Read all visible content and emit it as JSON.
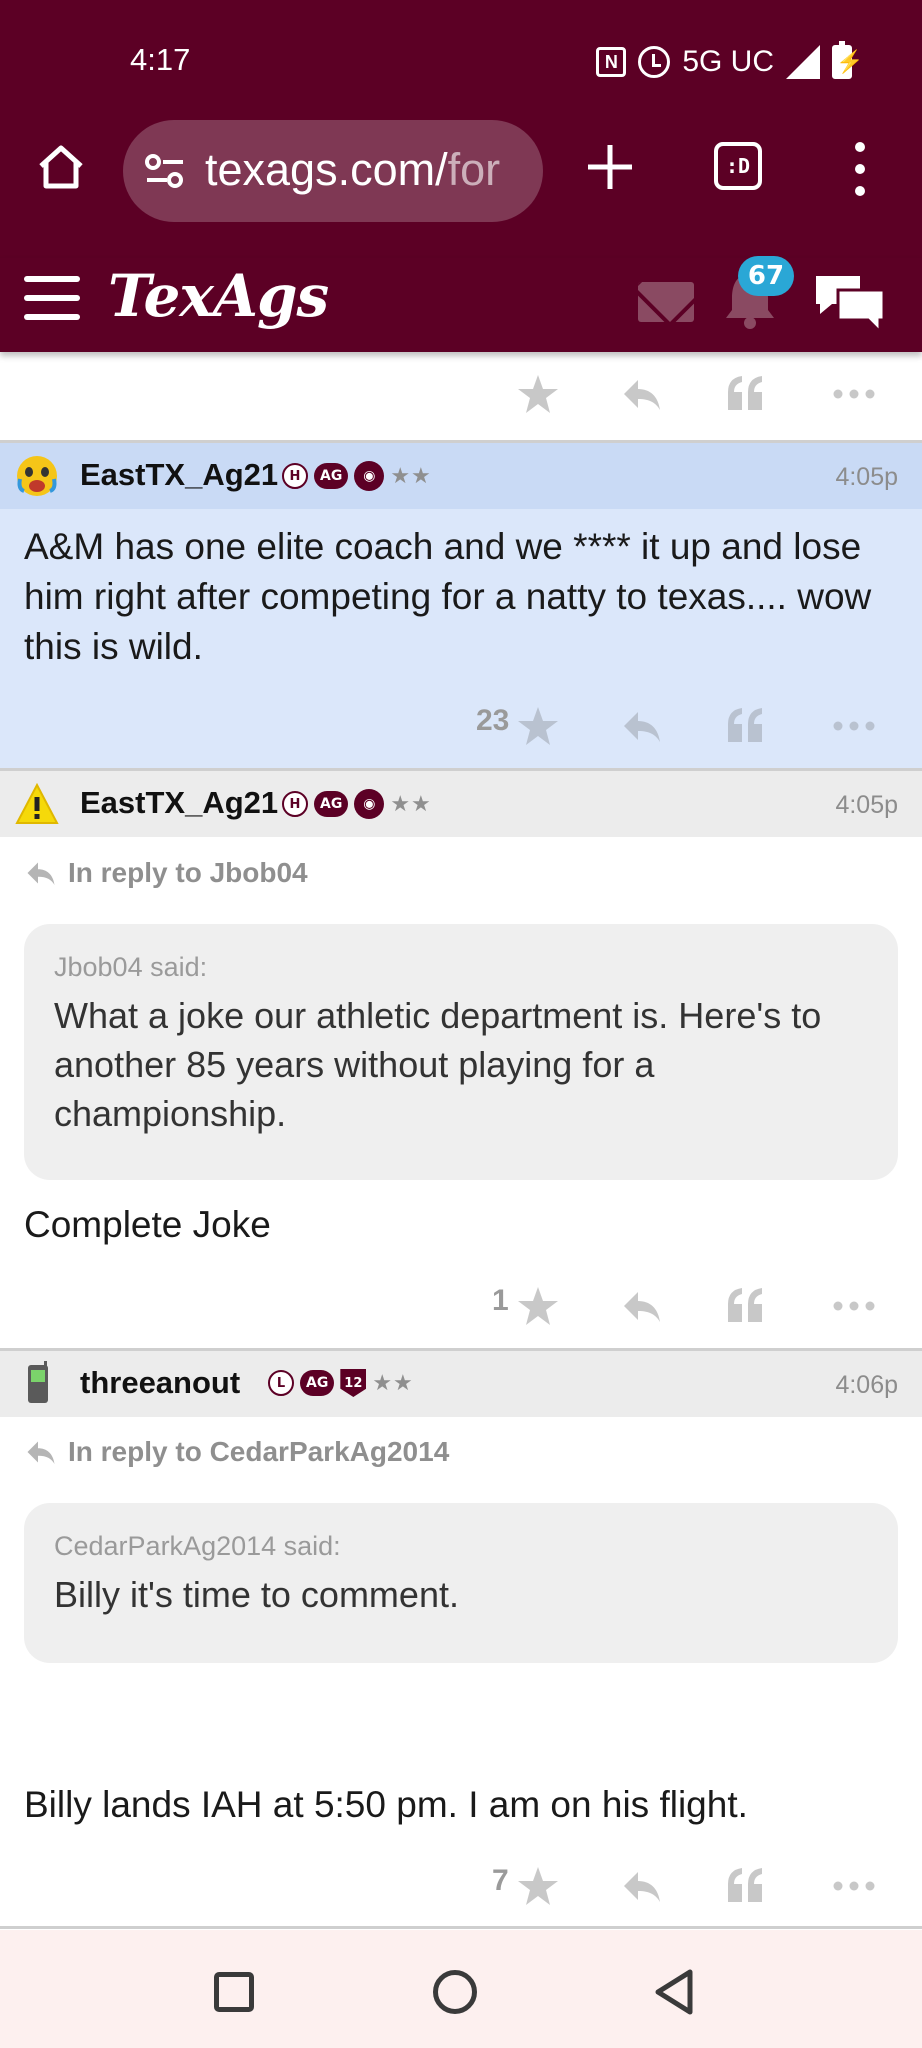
{
  "status_bar": {
    "time": "4:17",
    "network": "5G UC"
  },
  "browser": {
    "url_main": "texags.com/",
    "url_faded": "for",
    "tabs_count": ":D"
  },
  "site": {
    "logo": "TexAgs",
    "notification_count": "67",
    "accent_color": "#5c0025"
  },
  "posts": [
    {
      "username": "EastTX_Ag21",
      "badges": [
        "H",
        "AG"
      ],
      "time": "4:05p",
      "body": "A&M has one elite coach and we **** it up and lose him right after competing for a natty to texas.... wow this is wild.",
      "star_count": "23",
      "highlighted": true
    },
    {
      "username": "EastTX_Ag21",
      "badges": [
        "H",
        "AG"
      ],
      "time": "4:05p",
      "reply_to": "In reply to Jbob04",
      "quote_author": "Jbob04 said:",
      "quote_text": "What a joke our athletic department is. Here's to another 85 years without playing for a championship.",
      "body": "Complete Joke",
      "star_count": "1"
    },
    {
      "username": "threeanout",
      "badges": [
        "L",
        "AG",
        "12"
      ],
      "time": "4:06p",
      "reply_to": "In reply to CedarParkAg2014",
      "quote_author": "CedarParkAg2014 said:",
      "quote_text": "Billy it's time to comment.",
      "body": "Billy lands IAH at 5:50 pm. I am on his flight.",
      "star_count": "7"
    }
  ],
  "star_glyph": "★",
  "rank_stars": "★★"
}
